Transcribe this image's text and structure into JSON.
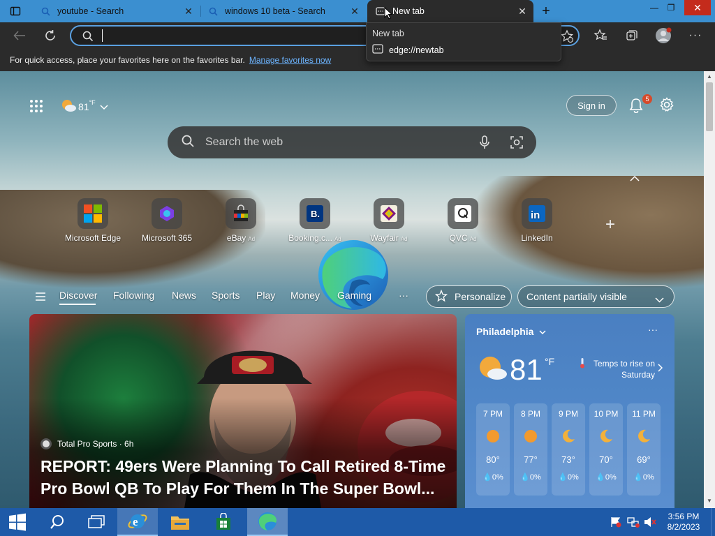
{
  "tabs": [
    {
      "label": "youtube - Search",
      "icon": "search-icon"
    },
    {
      "label": "windows 10 beta - Search",
      "icon": "search-icon"
    },
    {
      "label": "New tab",
      "icon": "newtab-icon"
    }
  ],
  "dropdown": {
    "title": "New tab",
    "url": "edge://newtab"
  },
  "address": {
    "value": "",
    "placeholder": ""
  },
  "favbar": {
    "text": "For quick access, place your favorites here on the favorites bar.",
    "link": "Manage favorites now"
  },
  "ntp": {
    "temp": "81",
    "unit": "°F",
    "sign_in": "Sign in",
    "notifications": "5",
    "search_placeholder": "Search the web",
    "quicklinks": [
      {
        "label": "Microsoft Edge",
        "ad": ""
      },
      {
        "label": "Microsoft 365",
        "ad": ""
      },
      {
        "label": "eBay",
        "ad": "Ad"
      },
      {
        "label": "Booking.c...",
        "ad": "Ad"
      },
      {
        "label": "Wayfair",
        "ad": "Ad"
      },
      {
        "label": "QVC",
        "ad": "Ad"
      },
      {
        "label": "LinkedIn",
        "ad": ""
      }
    ],
    "nav": [
      "Discover",
      "Following",
      "News",
      "Sports",
      "Play",
      "Money",
      "Gaming"
    ],
    "more": "···",
    "personalize": "Personalize",
    "visibility": "Content partially visible"
  },
  "hero": {
    "source": "Total Pro Sports · 6h",
    "headline": "REPORT: 49ers Were Planning To Call Retired 8-Time Pro Bowl QB To Play For Them In The Super Bowl..."
  },
  "weather": {
    "city": "Philadelphia",
    "temp": "81",
    "unit": "°F",
    "note": "Temps to rise on Saturday",
    "hours": [
      {
        "time": "7 PM",
        "icon": "sun-icon",
        "temp": "80°",
        "precip": "0%"
      },
      {
        "time": "8 PM",
        "icon": "sun-icon",
        "temp": "77°",
        "precip": "0%"
      },
      {
        "time": "9 PM",
        "icon": "moon-icon",
        "temp": "73°",
        "precip": "0%"
      },
      {
        "time": "10 PM",
        "icon": "moon-icon",
        "temp": "70°",
        "precip": "0%"
      },
      {
        "time": "11 PM",
        "icon": "moon-icon",
        "temp": "69°",
        "precip": "0%"
      }
    ]
  },
  "taskbar": {
    "time": "3:56 PM",
    "date": "8/2/2023"
  },
  "colors": {
    "titlebar": "#3b8fd0",
    "taskbar": "#1e5aa8",
    "accent": "#5aa0e0"
  }
}
